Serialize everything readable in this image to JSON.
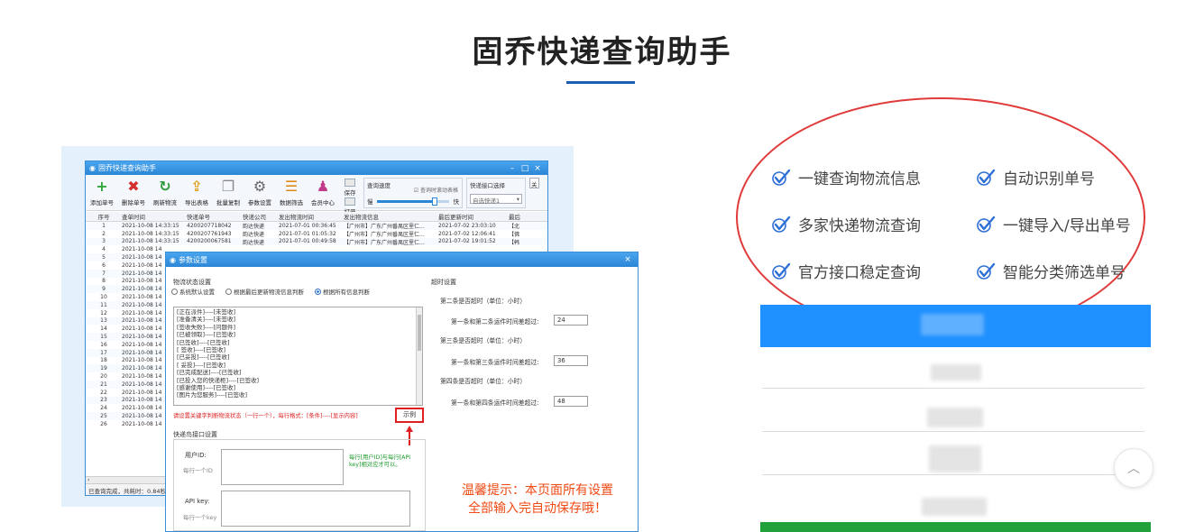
{
  "page": {
    "title": "固乔快递查询助手"
  },
  "app": {
    "window_title": "固乔快递查询助手",
    "toolbar": [
      {
        "label": "添加单号",
        "icon": "plus-icon",
        "color": "#2ea83a"
      },
      {
        "label": "删除单号",
        "icon": "delete-icon",
        "color": "#d32f2f"
      },
      {
        "label": "刷新物流",
        "icon": "refresh-icon",
        "color": "#2e9a3a"
      },
      {
        "label": "导出表格",
        "icon": "export-icon",
        "color": "#e0a21c"
      },
      {
        "label": "批量复制",
        "icon": "copy-icon",
        "color": "#8a8a8a"
      },
      {
        "label": "参数设置",
        "icon": "gear-icon",
        "color": "#666666"
      },
      {
        "label": "数据筛选",
        "icon": "filter-icon",
        "color": "#e08a1c"
      },
      {
        "label": "会员中心",
        "icon": "member-icon",
        "color": "#c23b8a"
      }
    ],
    "save_label": "保存",
    "open_label": "打开",
    "speed": {
      "title": "查询速度",
      "slow": "慢",
      "fast": "快",
      "checkbox": "查询时滚动表格"
    },
    "interface": {
      "title": "快递接口选择",
      "selected": "自选快递1"
    },
    "side_label": "关",
    "grid_headers": [
      "序号",
      "查单时间",
      "快递单号",
      "快递公司",
      "发出物流时间",
      "发出物流信息",
      "最后更新时间",
      "最后"
    ],
    "grid_rows": [
      [
        "1",
        "2021-10-08 14:33:15",
        "4200207718042",
        "韵达快递",
        "2021-07-01 00:36:45",
        "【广州市】广东广州番禺区里仁...",
        "2021-07-02 23:03:10",
        "【北"
      ],
      [
        "2",
        "2021-10-08 14:33:15",
        "4200207761943",
        "韵达快递",
        "2021-07-01 01:05:32",
        "【广州市】广东广州番禺区里仁...",
        "2021-07-02 12:06:41",
        "【佛"
      ],
      [
        "3",
        "2021-10-08 14:33:15",
        "4200200067581",
        "韵达快递",
        "2021-07-01 00:49:58",
        "【广州市】广东广州番禺区里仁...",
        "2021-07-02 19:01:52",
        "【韩"
      ],
      [
        "4",
        "2021-10-08 14",
        "",
        "",
        "",
        "",
        "",
        ""
      ],
      [
        "5",
        "2021-10-08 14",
        "",
        "",
        "",
        "",
        "",
        ""
      ],
      [
        "6",
        "2021-10-08 14",
        "",
        "",
        "",
        "",
        "",
        ""
      ],
      [
        "7",
        "2021-10-08 14",
        "",
        "",
        "",
        "",
        "",
        ""
      ],
      [
        "8",
        "2021-10-08 14",
        "",
        "",
        "",
        "",
        "",
        ""
      ],
      [
        "9",
        "2021-10-08 14",
        "",
        "",
        "",
        "",
        "",
        ""
      ],
      [
        "10",
        "2021-10-08 14",
        "",
        "",
        "",
        "",
        "",
        ""
      ],
      [
        "11",
        "2021-10-08 14",
        "",
        "",
        "",
        "",
        "",
        ""
      ],
      [
        "12",
        "2021-10-08 14",
        "",
        "",
        "",
        "",
        "",
        ""
      ],
      [
        "13",
        "2021-10-08 14",
        "",
        "",
        "",
        "",
        "",
        ""
      ],
      [
        "14",
        "2021-10-08 14",
        "",
        "",
        "",
        "",
        "",
        ""
      ],
      [
        "15",
        "2021-10-08 14",
        "",
        "",
        "",
        "",
        "",
        ""
      ],
      [
        "16",
        "2021-10-08 14",
        "",
        "",
        "",
        "",
        "",
        ""
      ],
      [
        "17",
        "2021-10-08 14",
        "",
        "",
        "",
        "",
        "",
        ""
      ],
      [
        "18",
        "2021-10-08 14",
        "",
        "",
        "",
        "",
        "",
        ""
      ],
      [
        "19",
        "2021-10-08 14",
        "",
        "",
        "",
        "",
        "",
        ""
      ],
      [
        "20",
        "2021-10-08 14",
        "",
        "",
        "",
        "",
        "",
        ""
      ],
      [
        "21",
        "2021-10-08 14",
        "",
        "",
        "",
        "",
        "",
        ""
      ],
      [
        "22",
        "2021-10-08 14",
        "",
        "",
        "",
        "",
        "",
        ""
      ],
      [
        "23",
        "2021-10-08 14",
        "",
        "",
        "",
        "",
        "",
        ""
      ],
      [
        "24",
        "2021-10-08 14",
        "",
        "",
        "",
        "",
        "",
        ""
      ],
      [
        "25",
        "2021-10-08 14",
        "",
        "",
        "",
        "",
        "",
        ""
      ],
      [
        "26",
        "2021-10-08 14",
        "",
        "",
        "",
        "",
        "",
        ""
      ]
    ],
    "status": "已查询完成，共耗时：0.84秒"
  },
  "dialog": {
    "title": "参数设置",
    "status_group": "物流状态设置",
    "radios": [
      {
        "label": "系统默认设置",
        "checked": false
      },
      {
        "label": "根据最后更新物流信息判断",
        "checked": false
      },
      {
        "label": "根据所有信息判断",
        "checked": true
      }
    ],
    "rules": [
      "[正在派件]----[未签收]",
      "[准备清关]----[未签收]",
      "[签收失败]----[问题件]",
      "[已被领取]----[已签收]",
      "[已签收]----[已签收]",
      "[ 签收]----[已签收]",
      "[已妥投]----[已签收]",
      "[ 妥投]----[已签收]",
      "[已完成配送]----[已签收]",
      "[已投入您的快递柜]----[已签收]",
      "[感谢使用]----[已签收]",
      "[图片为您服务]----[已签收]"
    ],
    "hint": "请设置关键字判断物流状态（一行一个），每行格式：[条件]----[显示内容]",
    "example_button": "示例",
    "kd_group": "快递鸟接口设置",
    "user_id_label": "用户ID:",
    "user_id_sub": "每行一个ID",
    "user_id_note": "每行[用户ID]与每行[API key]相对应才可以。",
    "api_key_label": "API key:",
    "api_key_sub": "每行一个key",
    "timeout_group": "超时设置",
    "timeout_items": [
      {
        "title": "第二条是否超时（单位：小时）",
        "label": "第一条和第二条运件时间差超过:",
        "value": "24"
      },
      {
        "title": "第三条是否超时（单位：小时）",
        "label": "第一条和第三条运件时间差超过:",
        "value": "36"
      },
      {
        "title": "第四条是否超时（单位：小时）",
        "label": "第一条和第四条运件时间差超过:",
        "value": "48"
      }
    ],
    "warm_line1": "温馨提示：本页面所有设置",
    "warm_line2": "全部输入完自动保存哦！"
  },
  "features": [
    "一键查询物流信息",
    "自动识别单号",
    "多家快递物流查询",
    "一键导入/导出单号",
    "官方接口稳定查询",
    "智能分类筛选单号"
  ],
  "colors": {
    "accent": "#1e90ff",
    "green": "#22a03c",
    "highlight": "#e03a3a",
    "title_underline": "#1a5fb4"
  }
}
